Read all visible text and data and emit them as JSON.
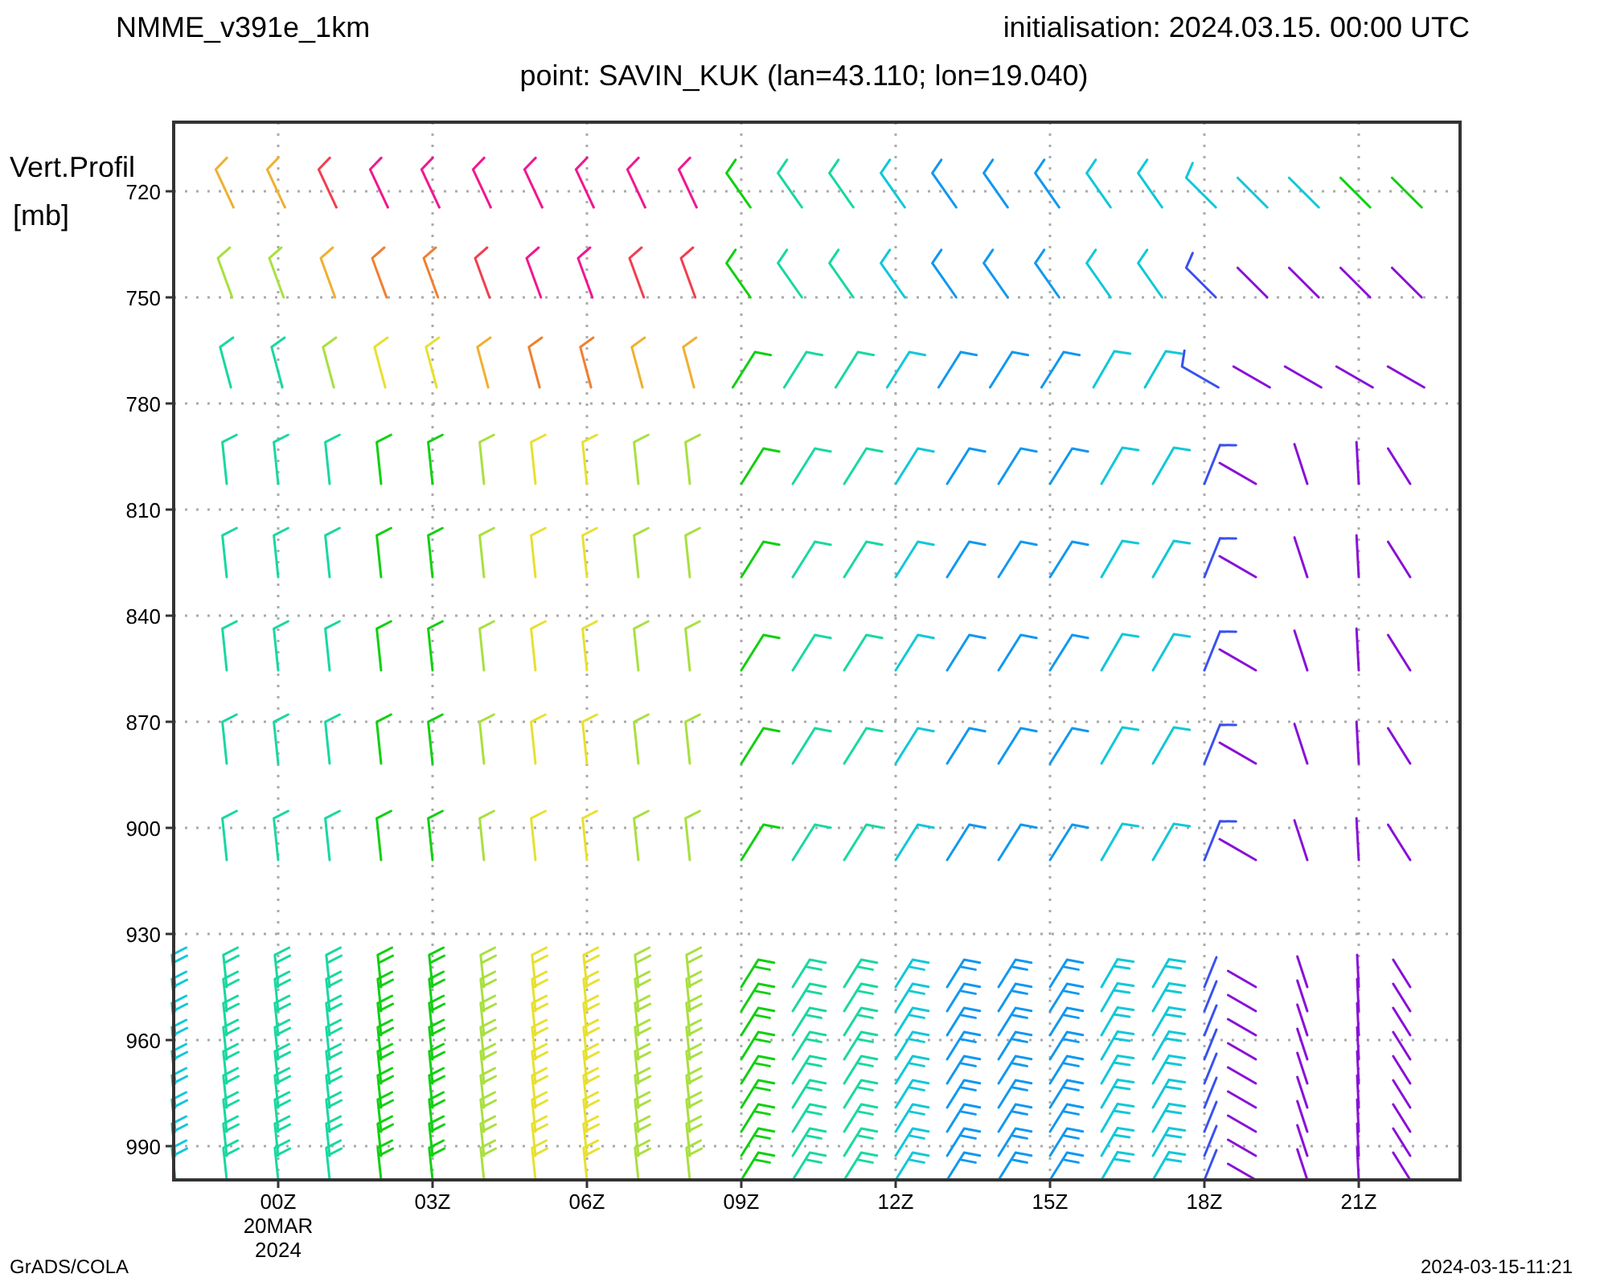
{
  "header": {
    "model": "NMME_v391e_1km",
    "initialisation": "initialisation: 2024.03.15. 00:00 UTC"
  },
  "subtitle": "point: SAVIN_KUK (lan=43.110; lon=19.040)",
  "y_axis": {
    "title": "Vert.Profil",
    "unit": "[mb]",
    "ticks": [
      "720",
      "750",
      "780",
      "810",
      "840",
      "870",
      "900",
      "930",
      "960",
      "990"
    ]
  },
  "x_axis": {
    "ticks": [
      {
        "label": "00Z",
        "date": "20MAR",
        "year": "2024"
      },
      {
        "label": "03Z"
      },
      {
        "label": "06Z"
      },
      {
        "label": "09Z"
      },
      {
        "label": "12Z"
      },
      {
        "label": "15Z"
      },
      {
        "label": "18Z"
      },
      {
        "label": "21Z"
      }
    ]
  },
  "footer": {
    "left": "GrADS/COLA",
    "right": "2024-03-15-11:21"
  }
}
